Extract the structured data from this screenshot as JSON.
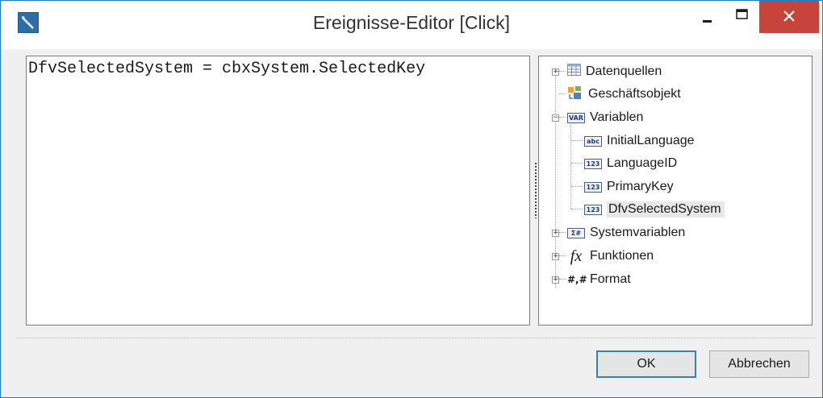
{
  "window": {
    "title": "Ereignisse-Editor [Click]"
  },
  "editor": {
    "code": "DfvSelectedSystem = cbxSystem.SelectedKey"
  },
  "tree": {
    "items": [
      {
        "label": "Datenquellen",
        "icon": "table-icon"
      },
      {
        "label": "Geschäftsobjekt",
        "icon": "business-object-icon"
      },
      {
        "label": "Variablen",
        "icon": "var-icon"
      },
      {
        "label": "InitialLanguage",
        "icon": "abc-icon"
      },
      {
        "label": "LanguageID",
        "icon": "123-icon"
      },
      {
        "label": "PrimaryKey",
        "icon": "123-icon"
      },
      {
        "label": "DfvSelectedSystem",
        "icon": "123-icon"
      },
      {
        "label": "Systemvariablen",
        "icon": "sigma-icon"
      },
      {
        "label": "Funktionen",
        "icon": "fx-icon"
      },
      {
        "label": "Format",
        "icon": "hash-icon"
      }
    ],
    "tags": {
      "var": "VAR",
      "abc": "abc",
      "num": "123",
      "sys": "Σ#",
      "fx": "fx",
      "fmt": "#,#"
    }
  },
  "buttons": {
    "ok_label": "OK",
    "cancel_label": "Abbrechen"
  }
}
